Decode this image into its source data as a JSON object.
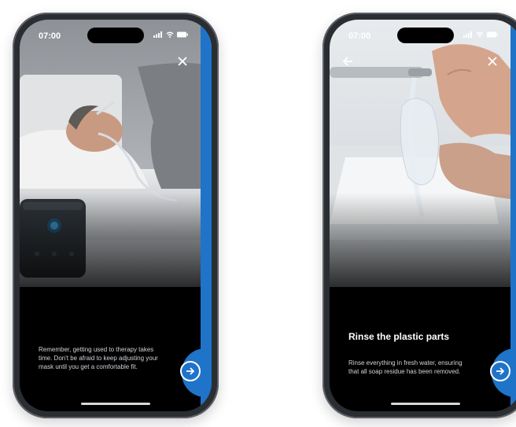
{
  "colors": {
    "accent": "#1f73c8",
    "background": "#000000",
    "text": "#ffffff",
    "body_text": "#cfd3d8"
  },
  "left_phone": {
    "status": {
      "time": "07:00"
    },
    "close_icon": "close-icon",
    "photo": "man sleeping with CPAP mask",
    "body": "Remember, getting used to therapy takes time. Don't be afraid to keep adjusting your mask until you get a comfortable fit.",
    "next_icon": "arrow-right-circle-icon"
  },
  "right_phone": {
    "status": {
      "time": "07:00"
    },
    "back_icon": "arrow-left-icon",
    "close_icon": "close-icon",
    "photo": "hands rinsing plastic mask parts under a faucet",
    "title": "Rinse the plastic parts",
    "body": "Rinse everything in fresh water, ensuring that all soap residue has been removed.",
    "next_icon": "arrow-right-circle-icon"
  }
}
